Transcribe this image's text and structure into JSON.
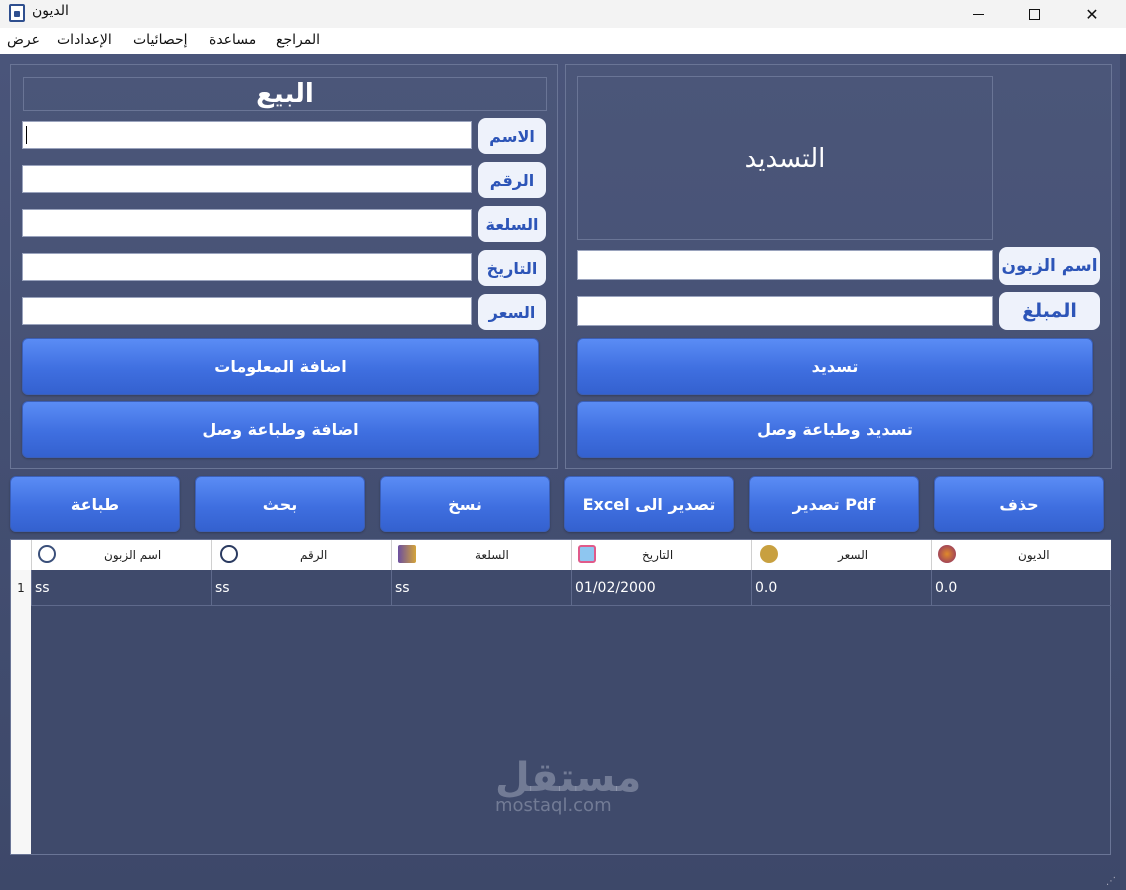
{
  "window": {
    "title": "الديون"
  },
  "menu": {
    "items": [
      "المراجع",
      "مساعدة",
      "إحصائيات",
      "الإعدادات",
      "عرض"
    ]
  },
  "sale": {
    "title": "البيع",
    "fields": [
      {
        "label": "الاسم",
        "value": ""
      },
      {
        "label": "الرقم",
        "value": ""
      },
      {
        "label": "السلعة",
        "value": ""
      },
      {
        "label": "التاريخ",
        "value": ""
      },
      {
        "label": "السعر",
        "value": ""
      }
    ],
    "add_button": "اضافة المعلومات",
    "add_print_button": "اضافة وطباعة وصل"
  },
  "payment": {
    "title": "التسديد",
    "fields": [
      {
        "label": "اسم الزبون",
        "value": ""
      },
      {
        "label": "المبلغ",
        "value": ""
      }
    ],
    "pay_button": "تسديد",
    "pay_print_button": "تسديد وطباعة وصل"
  },
  "toolbar": {
    "delete": "حذف",
    "export_pdf": "Pdf تصدير",
    "export_excel": "تصدير الى Excel",
    "copy": "نسخ",
    "search": "بحث",
    "print": "طباعة"
  },
  "table": {
    "columns": [
      "اسم الزبون",
      "الرقم",
      "السلعة",
      "التاريخ",
      "السعر",
      "الديون"
    ],
    "column_icons": [
      "user-icon",
      "phone-icon",
      "goods-icon",
      "calendar-icon",
      "money-bag-icon",
      "debt-icon"
    ],
    "rows": [
      {
        "num": "1",
        "cells": [
          "ss",
          "ss",
          "ss",
          "01/02/2000",
          "0.0",
          "0.0"
        ]
      }
    ]
  },
  "watermark": {
    "arabic": "مستقل",
    "latin": "mostaql.com"
  }
}
